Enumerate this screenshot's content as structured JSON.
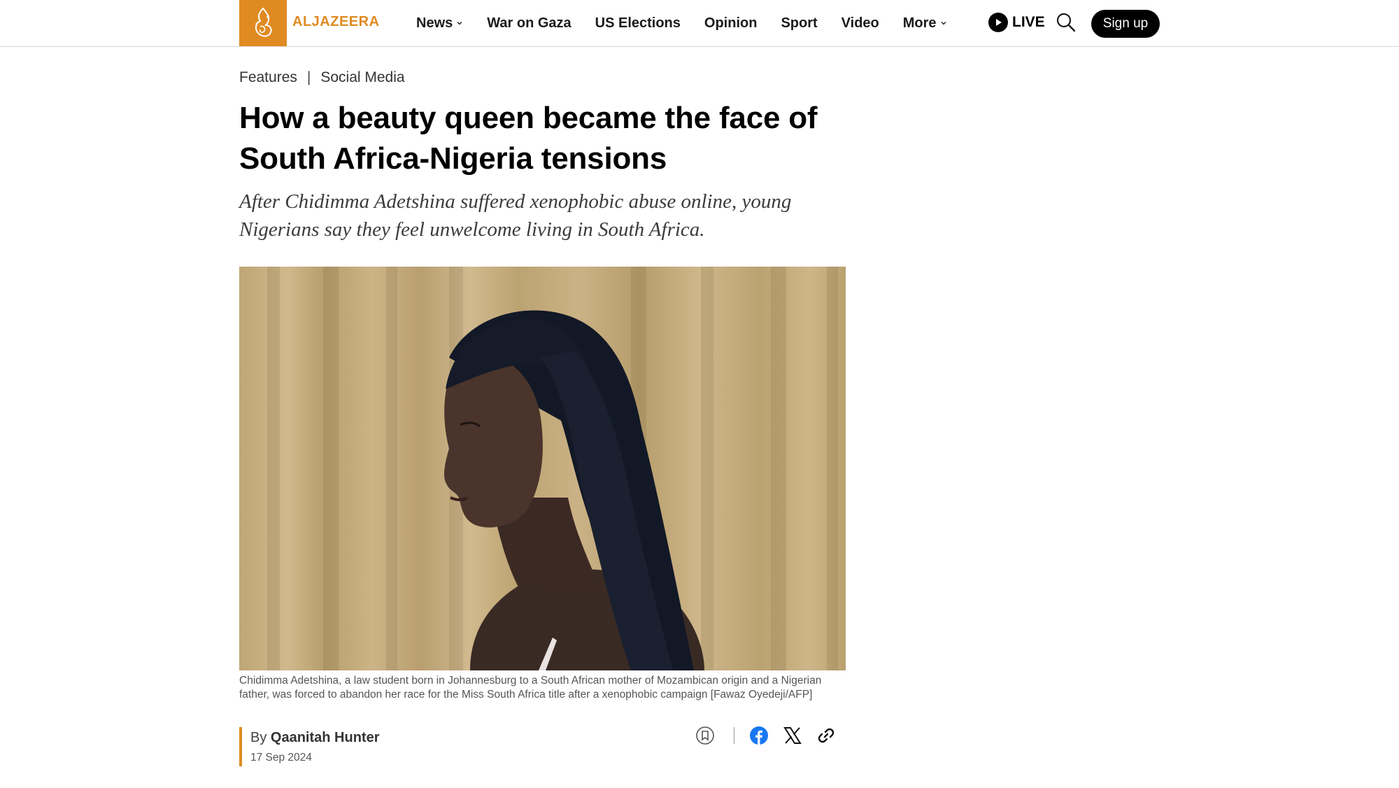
{
  "header": {
    "logo_text": "ALJAZEERA",
    "nav": [
      {
        "label": "News",
        "has_dropdown": true
      },
      {
        "label": "War on Gaza",
        "has_dropdown": false
      },
      {
        "label": "US Elections",
        "has_dropdown": false
      },
      {
        "label": "Opinion",
        "has_dropdown": false
      },
      {
        "label": "Sport",
        "has_dropdown": false
      },
      {
        "label": "Video",
        "has_dropdown": false
      },
      {
        "label": "More",
        "has_dropdown": true
      }
    ],
    "live_label": "LIVE",
    "signup_label": "Sign up",
    "search_icon": "search-icon"
  },
  "article": {
    "breadcrumb": [
      "Features",
      "Social Media"
    ],
    "breadcrumb_separator": "|",
    "title": "How a beauty queen became the face of South Africa-Nigeria tensions",
    "subtitle": "After Chidimma Adetshina suffered xenophobic abuse online, young Nigerians say they feel unwelcome living in South Africa.",
    "caption": "Chidimma Adetshina, a law student born in Johannesburg to a South African mother of Mozambican origin and a Nigerian father, was forced to abandon her race for the Miss South Africa title after a xenophobic campaign [Fawaz Oyedeji/AFP]",
    "byline_prefix": "By",
    "author": "Qaanitah Hunter",
    "date": "17 Sep 2024"
  },
  "share_icons": [
    "bookmark-icon",
    "facebook-icon",
    "x-icon",
    "link-icon"
  ],
  "colors": {
    "brand": "#e08a22",
    "facebook": "#1877f2",
    "text": "#000000"
  }
}
